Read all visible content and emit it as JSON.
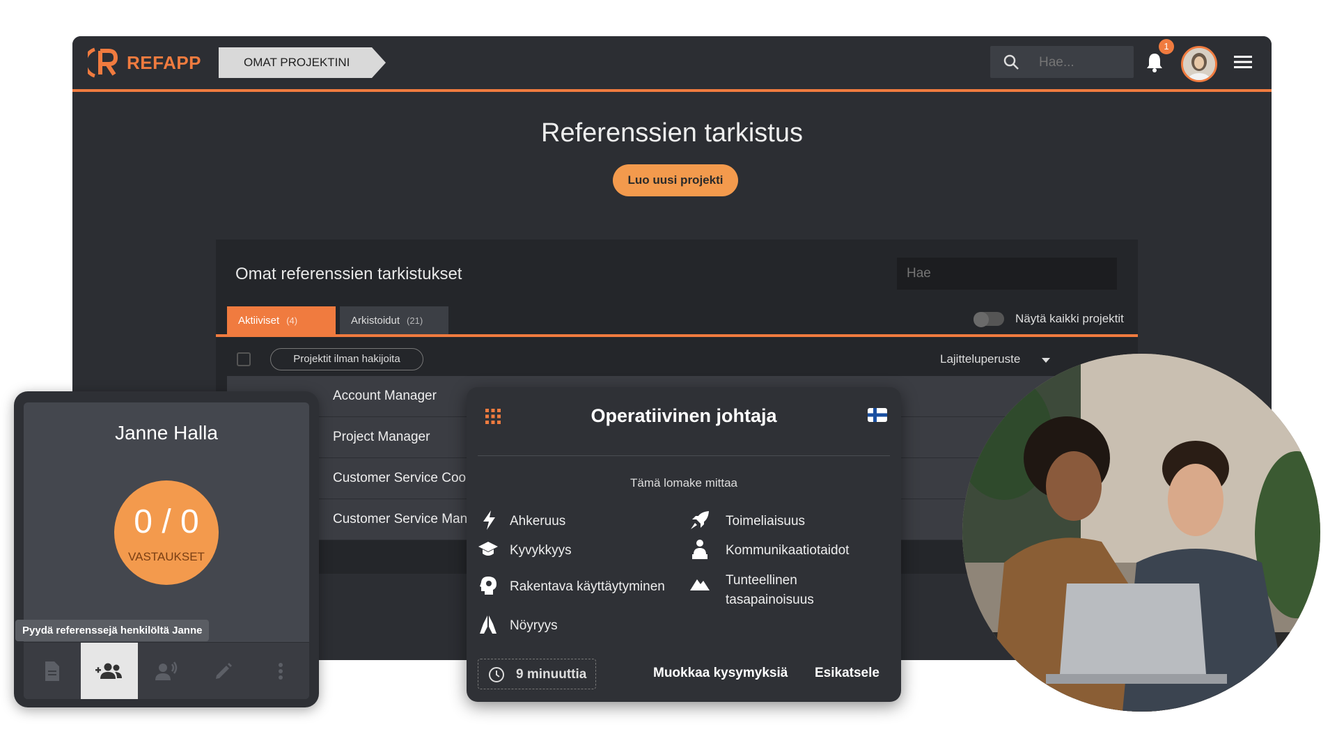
{
  "header": {
    "logo_text": "REFAPP",
    "breadcrumb": "OMAT PROJEKTINI",
    "search_placeholder": "Hae...",
    "notification_count": "1",
    "accent_color": "#f07b3f"
  },
  "main": {
    "title": "Referenssien tarkistus",
    "create_button": "Luo uusi projekti"
  },
  "panel": {
    "title": "Omat referenssien tarkistukset",
    "search_placeholder": "Hae",
    "tabs": [
      {
        "label": "Aktiiviset",
        "count": "(4)"
      },
      {
        "label": "Arkistoidut",
        "count": "(21)"
      }
    ],
    "toggle_label": "Näytä kaikki projektit",
    "filter_chip": "Projektit ilman hakijoita",
    "sort_label": "Lajitteluperuste",
    "rows": [
      "Account Manager",
      "Project Manager",
      "Customer Service Coor",
      "Customer Service Mana"
    ]
  },
  "candidate_card": {
    "name": "Janne Halla",
    "score": "0 / 0",
    "score_label": "VASTAUKSET",
    "tooltip": "Pyydä referenssejä henkilöltä Janne",
    "toolbar_icons": [
      "document-icon",
      "add-people-icon",
      "voice-icon",
      "edit-icon",
      "more-icon"
    ]
  },
  "form_modal": {
    "title": "Operatiivinen johtaja",
    "measures_label": "Tämä lomake mittaa",
    "traits_left": [
      {
        "label": "Ahkeruus",
        "icon": "lightning-icon"
      },
      {
        "label": "Kyvykkyys",
        "icon": "graduation-cap-icon"
      },
      {
        "label": "Rakentava käyttäytyminen",
        "icon": "head-idea-icon"
      },
      {
        "label": "Nöyryys",
        "icon": "praying-hands-icon"
      }
    ],
    "traits_right": [
      {
        "label": "Toimeliaisuus",
        "icon": "rocket-icon"
      },
      {
        "label": "Kommunikaatiotaidot",
        "icon": "presenter-icon"
      },
      {
        "label": "Tunteellinen tasapainoisuus",
        "icon": "mountain-icon"
      }
    ],
    "duration": "9 minuuttia",
    "edit_button": "Muokkaa kysymyksiä",
    "preview_button": "Esikatsele"
  }
}
